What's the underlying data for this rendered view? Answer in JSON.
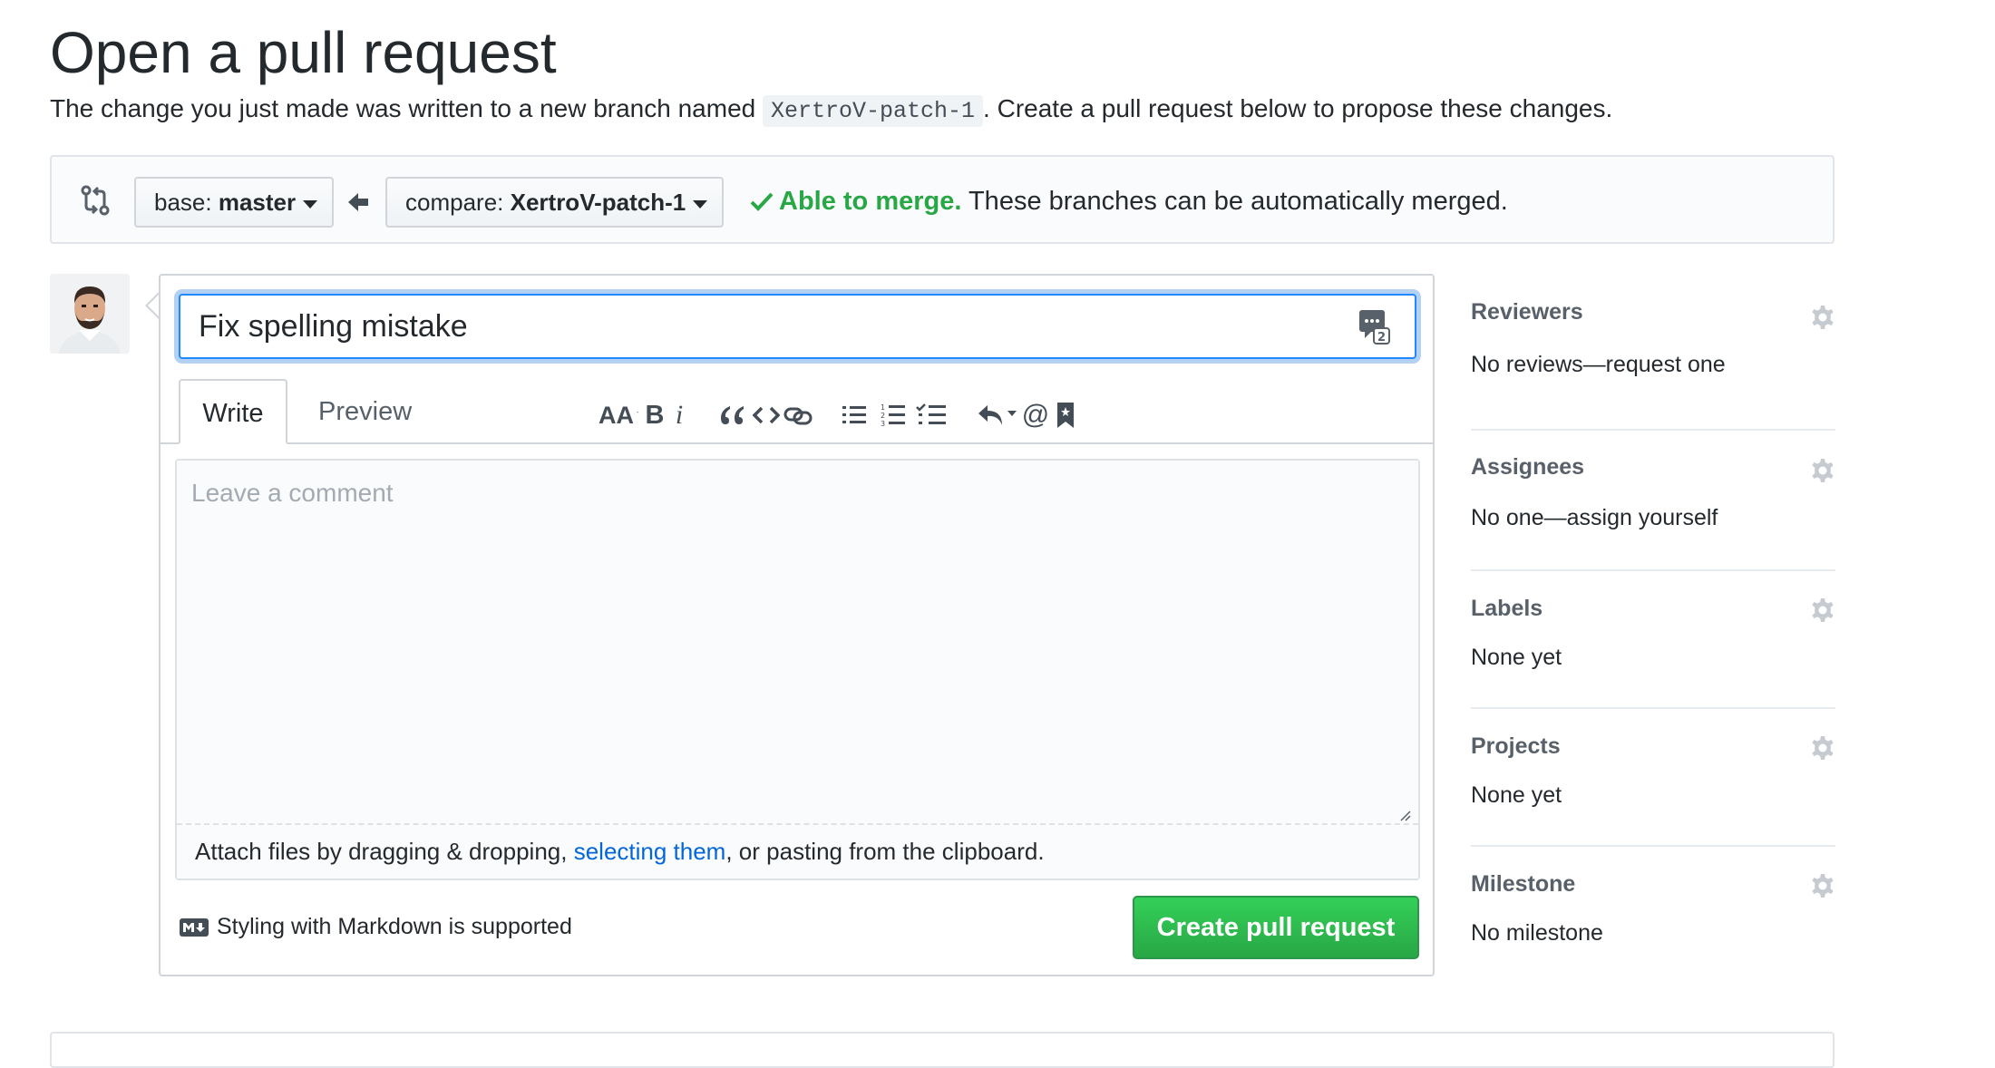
{
  "page": {
    "title": "Open a pull request",
    "subtitle_before": "The change you just made was written to a new branch named ",
    "branch_name": "XertroV-patch-1",
    "subtitle_after": ". Create a pull request below to propose these changes."
  },
  "compare": {
    "base_label": "base: ",
    "base_value": "master",
    "compare_label": "compare: ",
    "compare_value": "XertroV-patch-1",
    "status_ok": "Able to merge.",
    "status_text": " These branches can be automatically merged."
  },
  "form": {
    "title_value": "Fix spelling mistake",
    "tabs": [
      {
        "label": "Write",
        "active": true
      },
      {
        "label": "Preview",
        "active": false
      }
    ],
    "comment_placeholder": "Leave a comment",
    "attach_before": "Attach files by dragging & dropping, ",
    "attach_link": "selecting them",
    "attach_after": ", or pasting from the clipboard.",
    "markdown_note": "Styling with Markdown is supported",
    "submit_label": "Create pull request"
  },
  "toolbar": {
    "icons": [
      "text-size-icon",
      "bold-icon",
      "italic-icon",
      "quote-icon",
      "code-icon",
      "link-icon",
      "unordered-list-icon",
      "ordered-list-icon",
      "task-list-icon",
      "reply-icon",
      "mention-icon",
      "bookmark-icon"
    ],
    "header_text": "AA",
    "bold_text": "B",
    "italic_text": "i",
    "mention_text": "@"
  },
  "sidebar": {
    "items": [
      {
        "label": "Reviewers",
        "value": "No reviews—request one"
      },
      {
        "label": "Assignees",
        "value": "No one—assign yourself"
      },
      {
        "label": "Labels",
        "value": "None yet"
      },
      {
        "label": "Projects",
        "value": "None yet"
      },
      {
        "label": "Milestone",
        "value": "No milestone"
      }
    ]
  },
  "colors": {
    "accent_green": "#28a745",
    "link_blue": "#0366d6",
    "focus_blue": "#2188ff",
    "text": "#24292e",
    "muted": "#586069"
  }
}
